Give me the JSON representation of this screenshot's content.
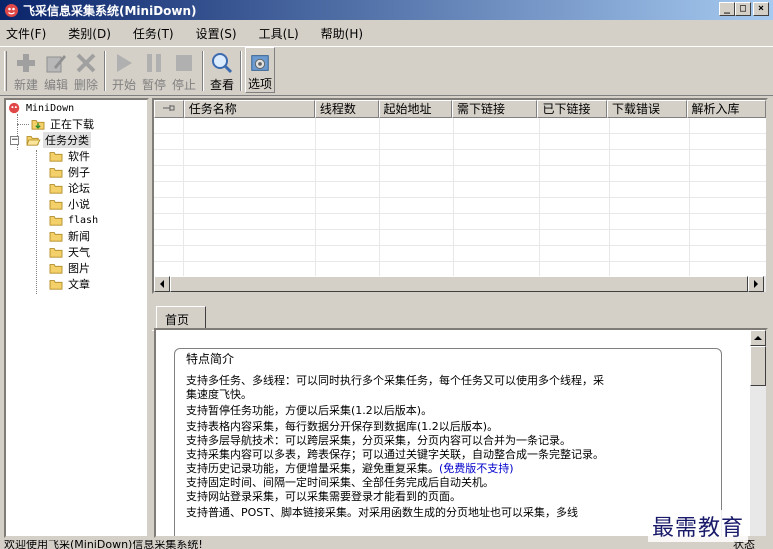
{
  "window": {
    "title": "飞采信息采集系统(MiniDown)",
    "minimize": "_",
    "maximize": "□",
    "close": "×"
  },
  "menu": {
    "items": [
      "文件(F)",
      "类别(D)",
      "任务(T)",
      "设置(S)",
      "工具(L)",
      "帮助(H)"
    ]
  },
  "toolbar": {
    "buttons": [
      {
        "label": "新建",
        "icon": "plus-icon",
        "enabled": false
      },
      {
        "label": "编辑",
        "icon": "edit-icon",
        "enabled": false
      },
      {
        "label": "删除",
        "icon": "delete-icon",
        "enabled": false
      },
      {
        "label": "开始",
        "icon": "play-icon",
        "enabled": false
      },
      {
        "label": "暂停",
        "icon": "pause-icon",
        "enabled": false
      },
      {
        "label": "停止",
        "icon": "stop-icon",
        "enabled": false
      },
      {
        "label": "查看",
        "icon": "magnifier-icon",
        "enabled": true
      },
      {
        "label": "选项",
        "icon": "options-icon",
        "enabled": true
      }
    ]
  },
  "tree": {
    "root": "MiniDown",
    "downloading": "正在下载",
    "category_root": "任务分类",
    "categories": [
      "软件",
      "例子",
      "论坛",
      "小说",
      "flash",
      "新闻",
      "天气",
      "图片",
      "文章"
    ],
    "expand_toggle": "−"
  },
  "list": {
    "columns": [
      "任务名称",
      "线程数",
      "起始地址",
      "需下链接",
      "已下链接",
      "下载错误",
      "解析入库"
    ],
    "first_col_icon": "pin-icon"
  },
  "tabs": {
    "home": "首页"
  },
  "content": {
    "heading": "特点简介",
    "lines": [
      "支持多任务、多线程：可以同时执行多个采集任务，每个任务又可以使用多个线程，采",
      "集速度飞快。",
      "支持暂停任务功能，方便以后采集(1.2以后版本)。",
      "支持表格内容采集，每行数据分开保存到数据库(1.2以后版本)。",
      "支持多层导航技术：可以跨层采集，分页采集，分页内容可以合并为一条记录。",
      "支持采集内容可以多表，跨表保存；可以通过关键字关联，自动整合成一条完整记录。",
      "支持历史记录功能，方便增量采集，避免重复采集。",
      "支持固定时间、间隔一定时间采集、全部任务完成后自动关机。",
      "支持网站登录采集，可以采集需要登录才能看到的页面。",
      "支持普通、POST、脚本链接采集。对采用函数生成的分页地址也可以采集，多线"
    ],
    "history_note": "(免费版不支持)"
  },
  "status": {
    "left": "欢迎使用飞采(MiniDown)信息采集系统!",
    "right": "状态"
  },
  "watermark": "最需教育",
  "colors": {
    "titlebar_start": "#0a246a",
    "titlebar_end": "#a6caf0",
    "face": "#d4d0c8",
    "link": "#0000cc"
  }
}
